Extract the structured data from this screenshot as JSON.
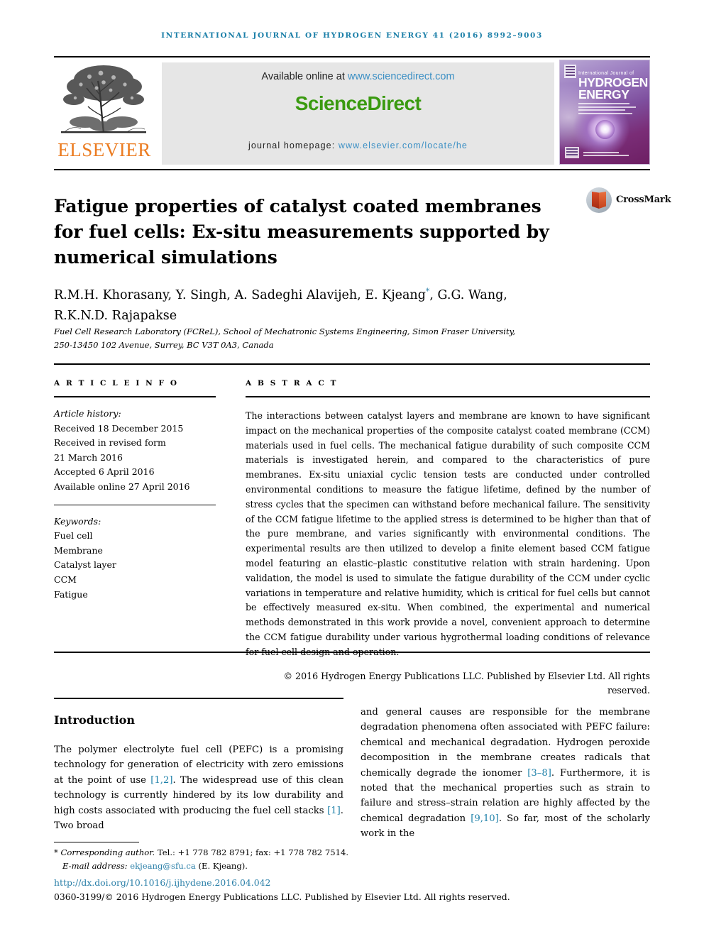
{
  "running_head": "International Journal of Hydrogen Energy 41 (2016) 8992–9003",
  "masthead": {
    "publisher": "ELSEVIER",
    "available_prefix": "Available online at ",
    "available_link": "www.sciencedirect.com",
    "wordmark_a": "Science",
    "wordmark_b": "Direct",
    "homepage_prefix": "journal homepage: ",
    "homepage_link": "www.elsevier.com/locate/he",
    "cover": {
      "prefix": "International Journal of",
      "line1": "HYDROGEN",
      "line2": "ENERGY"
    }
  },
  "crossmark": {
    "label": "CrossMark"
  },
  "article": {
    "title": "Fatigue properties of catalyst coated membranes for fuel cells: Ex-situ measurements supported by numerical simulations",
    "authors_line1": "R.M.H. Khorasany, Y. Singh, A. Sadeghi Alavijeh, E. Kjeang",
    "authors_star": "*",
    "authors_line1_tail": ", G.G. Wang,",
    "authors_line2": "R.K.N.D. Rajapakse",
    "affiliation_line1": "Fuel Cell Research Laboratory (FCReL), School of Mechatronic Systems Engineering, Simon Fraser University,",
    "affiliation_line2": "250-13450 102 Avenue, Surrey, BC V3T 0A3, Canada"
  },
  "article_info": {
    "heading": "A R T I C L E   I N F O",
    "history_label": "Article history:",
    "history": [
      "Received 18 December 2015",
      "Received in revised form",
      "21 March 2016",
      "Accepted 6 April 2016",
      "Available online 27 April 2016"
    ],
    "keywords_label": "Keywords:",
    "keywords": [
      "Fuel cell",
      "Membrane",
      "Catalyst layer",
      "CCM",
      "Fatigue"
    ]
  },
  "abstract": {
    "heading": "A B S T R A C T",
    "text": "The interactions between catalyst layers and membrane are known to have significant impact on the mechanical properties of the composite catalyst coated membrane (CCM) materials used in fuel cells. The mechanical fatigue durability of such composite CCM materials is investigated herein, and compared to the characteristics of pure membranes. Ex-situ uniaxial cyclic tension tests are conducted under controlled environmental conditions to measure the fatigue lifetime, defined by the number of stress cycles that the specimen can withstand before mechanical failure. The sensitivity of the CCM fatigue lifetime to the applied stress is determined to be higher than that of the pure membrane, and varies significantly with environmental conditions. The experimental results are then utilized to develop a finite element based CCM fatigue model featuring an elastic–plastic constitutive relation with strain hardening. Upon validation, the model is used to simulate the fatigue durability of the CCM under cyclic variations in temperature and relative humidity, which is critical for fuel cells but cannot be effectively measured ex-situ. When combined, the experimental and numerical methods demonstrated in this work provide a novel, convenient approach to determine the CCM fatigue durability under various hygrothermal loading conditions of relevance for fuel cell design and operation.",
    "copyright": "© 2016 Hydrogen Energy Publications LLC. Published by Elsevier Ltd. All rights reserved."
  },
  "introduction": {
    "heading": "Introduction",
    "left_p1_a": "The polymer electrolyte fuel cell (PEFC) is a promising technology for generation of electricity with zero emissions at the point of use ",
    "left_cite1": "[1,2]",
    "left_p1_b": ". The widespread use of this clean technology is currently hindered by its low durability and high costs associated with producing the fuel cell stacks ",
    "left_cite2": "[1]",
    "left_p1_c": ". Two broad",
    "right_a": "and general causes are responsible for the membrane degradation phenomena often associated with PEFC failure: chemical and mechanical degradation. Hydrogen peroxide decomposition in the membrane creates radicals that chemically degrade the ionomer ",
    "right_cite1": "[3–8]",
    "right_b": ". Furthermore, it is noted that the mechanical properties such as strain to failure and stress–strain relation are highly affected by the chemical degradation ",
    "right_cite2": "[9,10]",
    "right_c": ". So far, most of the scholarly work in the"
  },
  "footer": {
    "corresponding_star": "*",
    "corresponding_label": "Corresponding author.",
    "corresponding_contact": " Tel.: +1 778 782 8791; fax: +1 778 782 7514.",
    "email_label": "E-mail address: ",
    "email_link": "ekjeang@sfu.ca",
    "email_tail": " (E. Kjeang).",
    "doi": "http://dx.doi.org/10.1016/j.ijhydene.2016.04.042",
    "issn_line": "0360-3199/© 2016 Hydrogen Energy Publications LLC. Published by Elsevier Ltd. All rights reserved."
  },
  "colors": {
    "link_blue": "#2a7fa8",
    "sciencedirect_green": "#3a9a10",
    "elsevier_orange": "#eb7c21",
    "running_head_blue": "#1b7fa8"
  }
}
